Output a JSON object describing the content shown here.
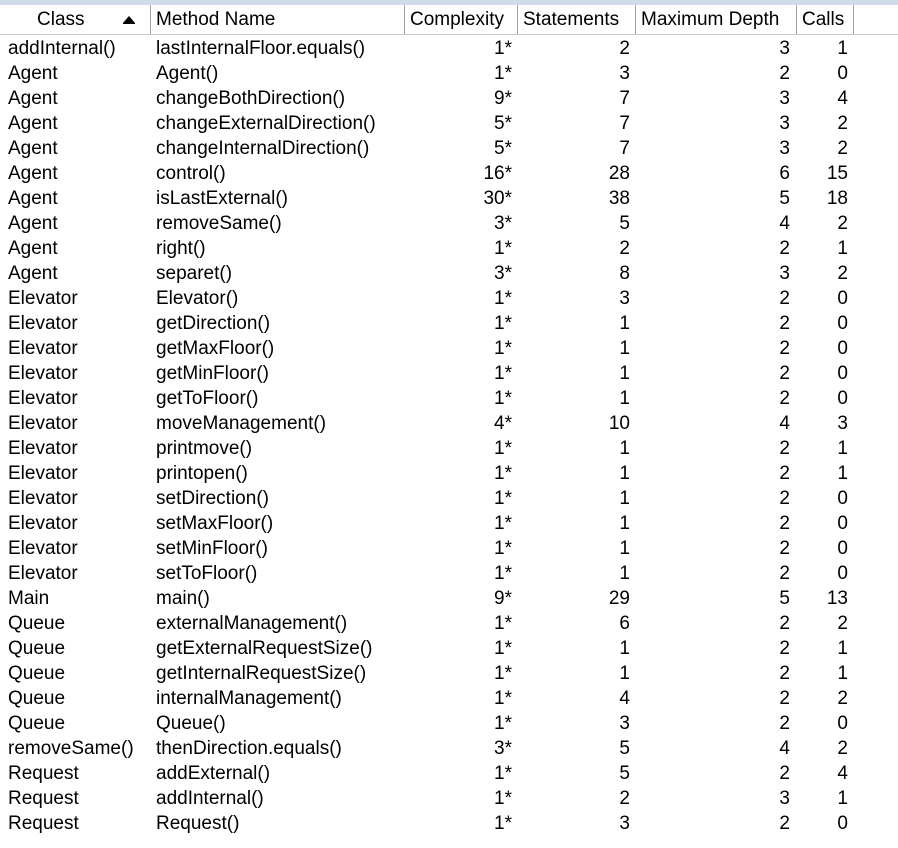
{
  "columns": {
    "class": "Class",
    "method": "Method Name",
    "complexity": "Complexity",
    "statements": "Statements",
    "depth": "Maximum Depth",
    "calls": "Calls"
  },
  "rows": [
    {
      "class": "addInternal()",
      "method": "lastInternalFloor.equals()",
      "complexity": "1*",
      "statements": "2",
      "depth": "3",
      "calls": "1"
    },
    {
      "class": "Agent",
      "method": "Agent()",
      "complexity": "1*",
      "statements": "3",
      "depth": "2",
      "calls": "0"
    },
    {
      "class": "Agent",
      "method": "changeBothDirection()",
      "complexity": "9*",
      "statements": "7",
      "depth": "3",
      "calls": "4"
    },
    {
      "class": "Agent",
      "method": "changeExternalDirection()",
      "complexity": "5*",
      "statements": "7",
      "depth": "3",
      "calls": "2"
    },
    {
      "class": "Agent",
      "method": "changeInternalDirection()",
      "complexity": "5*",
      "statements": "7",
      "depth": "3",
      "calls": "2"
    },
    {
      "class": "Agent",
      "method": "control()",
      "complexity": "16*",
      "statements": "28",
      "depth": "6",
      "calls": "15"
    },
    {
      "class": "Agent",
      "method": "isLastExternal()",
      "complexity": "30*",
      "statements": "38",
      "depth": "5",
      "calls": "18"
    },
    {
      "class": "Agent",
      "method": "removeSame()",
      "complexity": "3*",
      "statements": "5",
      "depth": "4",
      "calls": "2"
    },
    {
      "class": "Agent",
      "method": "right()",
      "complexity": "1*",
      "statements": "2",
      "depth": "2",
      "calls": "1"
    },
    {
      "class": "Agent",
      "method": "separet()",
      "complexity": "3*",
      "statements": "8",
      "depth": "3",
      "calls": "2"
    },
    {
      "class": "Elevator",
      "method": "Elevator()",
      "complexity": "1*",
      "statements": "3",
      "depth": "2",
      "calls": "0"
    },
    {
      "class": "Elevator",
      "method": "getDirection()",
      "complexity": "1*",
      "statements": "1",
      "depth": "2",
      "calls": "0"
    },
    {
      "class": "Elevator",
      "method": "getMaxFloor()",
      "complexity": "1*",
      "statements": "1",
      "depth": "2",
      "calls": "0"
    },
    {
      "class": "Elevator",
      "method": "getMinFloor()",
      "complexity": "1*",
      "statements": "1",
      "depth": "2",
      "calls": "0"
    },
    {
      "class": "Elevator",
      "method": "getToFloor()",
      "complexity": "1*",
      "statements": "1",
      "depth": "2",
      "calls": "0"
    },
    {
      "class": "Elevator",
      "method": "moveManagement()",
      "complexity": "4*",
      "statements": "10",
      "depth": "4",
      "calls": "3"
    },
    {
      "class": "Elevator",
      "method": "printmove()",
      "complexity": "1*",
      "statements": "1",
      "depth": "2",
      "calls": "1"
    },
    {
      "class": "Elevator",
      "method": "printopen()",
      "complexity": "1*",
      "statements": "1",
      "depth": "2",
      "calls": "1"
    },
    {
      "class": "Elevator",
      "method": "setDirection()",
      "complexity": "1*",
      "statements": "1",
      "depth": "2",
      "calls": "0"
    },
    {
      "class": "Elevator",
      "method": "setMaxFloor()",
      "complexity": "1*",
      "statements": "1",
      "depth": "2",
      "calls": "0"
    },
    {
      "class": "Elevator",
      "method": "setMinFloor()",
      "complexity": "1*",
      "statements": "1",
      "depth": "2",
      "calls": "0"
    },
    {
      "class": "Elevator",
      "method": "setToFloor()",
      "complexity": "1*",
      "statements": "1",
      "depth": "2",
      "calls": "0"
    },
    {
      "class": "Main",
      "method": "main()",
      "complexity": "9*",
      "statements": "29",
      "depth": "5",
      "calls": "13"
    },
    {
      "class": "Queue",
      "method": "externalManagement()",
      "complexity": "1*",
      "statements": "6",
      "depth": "2",
      "calls": "2"
    },
    {
      "class": "Queue",
      "method": "getExternalRequestSize()",
      "complexity": "1*",
      "statements": "1",
      "depth": "2",
      "calls": "1"
    },
    {
      "class": "Queue",
      "method": "getInternalRequestSize()",
      "complexity": "1*",
      "statements": "1",
      "depth": "2",
      "calls": "1"
    },
    {
      "class": "Queue",
      "method": "internalManagement()",
      "complexity": "1*",
      "statements": "4",
      "depth": "2",
      "calls": "2"
    },
    {
      "class": "Queue",
      "method": "Queue()",
      "complexity": "1*",
      "statements": "3",
      "depth": "2",
      "calls": "0"
    },
    {
      "class": "removeSame()",
      "method": "thenDirection.equals()",
      "complexity": "3*",
      "statements": "5",
      "depth": "4",
      "calls": "2"
    },
    {
      "class": "Request",
      "method": "addExternal()",
      "complexity": "1*",
      "statements": "5",
      "depth": "2",
      "calls": "4"
    },
    {
      "class": "Request",
      "method": "addInternal()",
      "complexity": "1*",
      "statements": "2",
      "depth": "3",
      "calls": "1"
    },
    {
      "class": "Request",
      "method": "Request()",
      "complexity": "1*",
      "statements": "3",
      "depth": "2",
      "calls": "0"
    }
  ]
}
